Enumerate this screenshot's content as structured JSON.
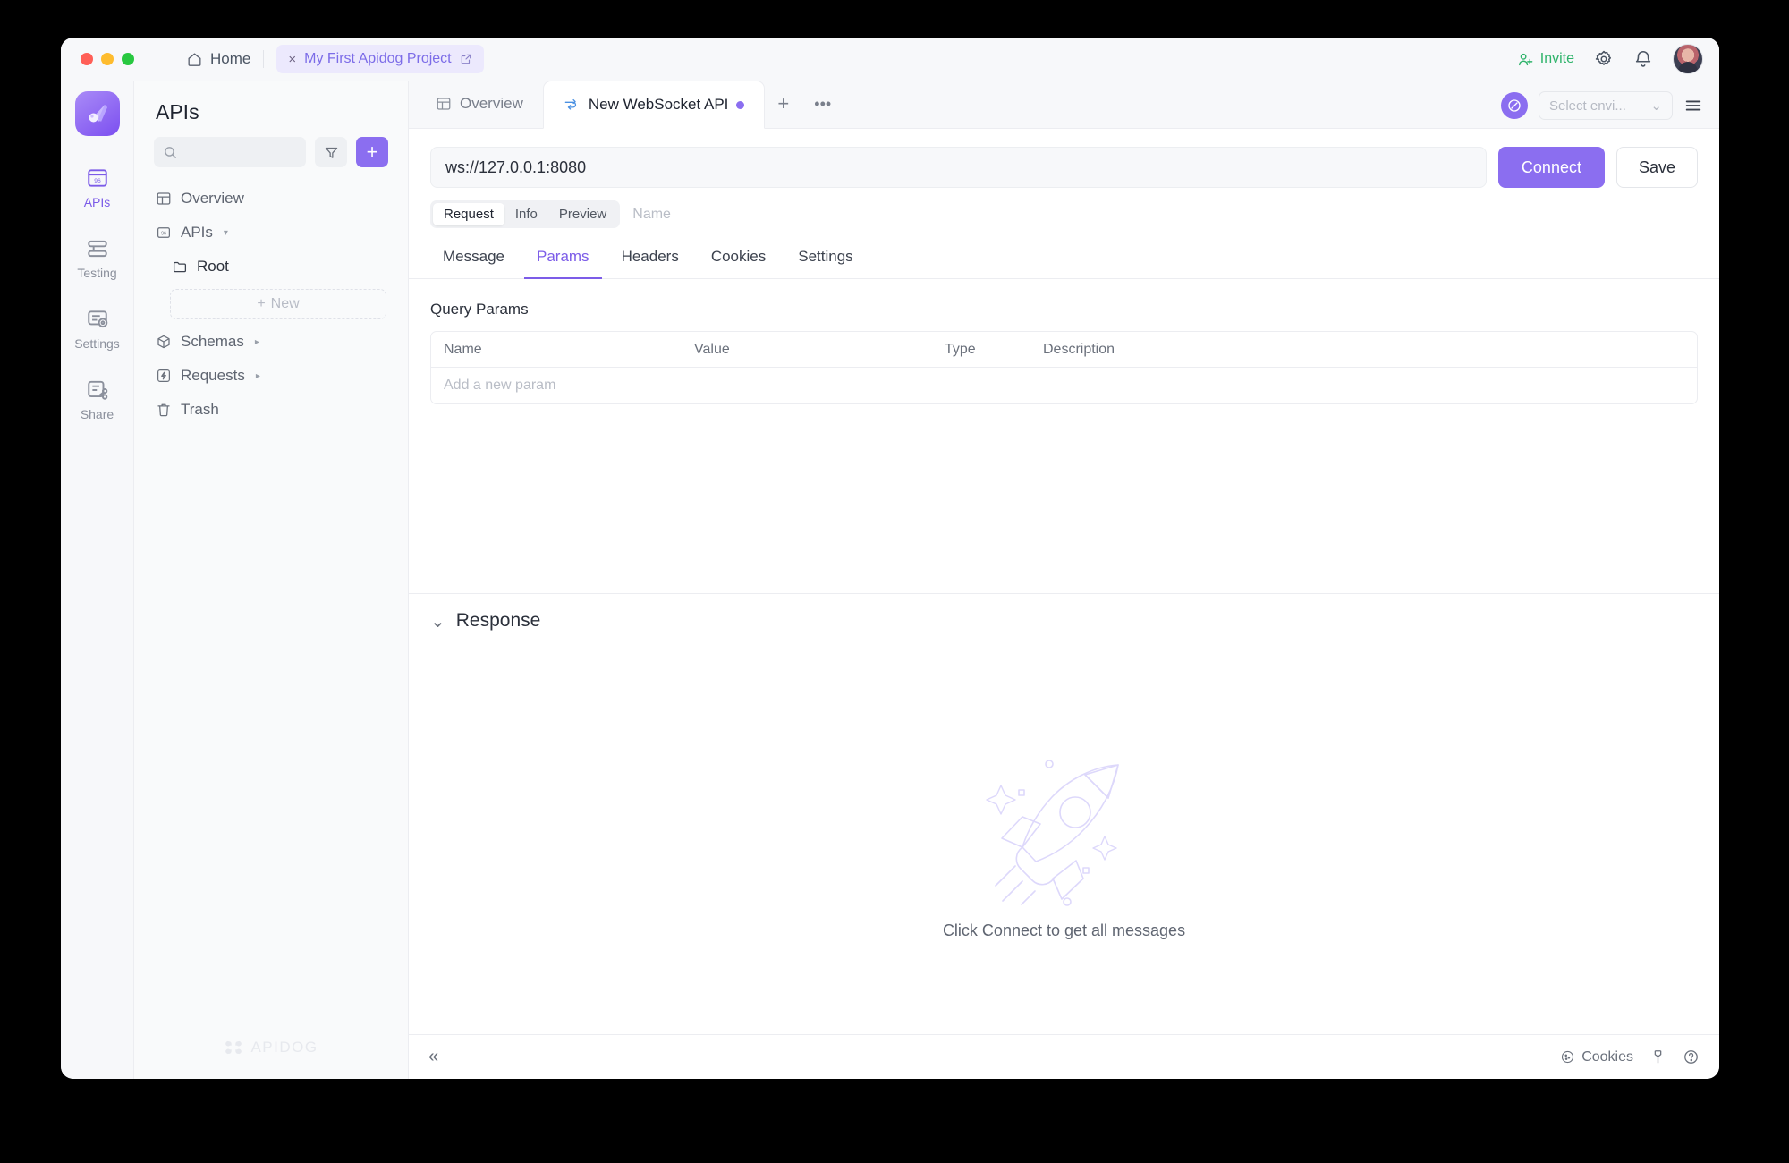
{
  "titlebar": {
    "home_label": "Home",
    "project_tab": "My First Apidog Project",
    "close_glyph": "×",
    "invite_label": "Invite"
  },
  "rail": {
    "items": [
      {
        "label": "APIs",
        "icon": "apis-icon",
        "active": true
      },
      {
        "label": "Testing",
        "icon": "testing-icon",
        "active": false
      },
      {
        "label": "Settings",
        "icon": "settings-icon",
        "active": false
      },
      {
        "label": "Share",
        "icon": "share-icon",
        "active": false
      }
    ]
  },
  "sidebar": {
    "title": "APIs",
    "search_placeholder": "",
    "add_glyph": "+",
    "items": [
      {
        "label": "Overview",
        "icon": "overview-icon",
        "caret": ""
      },
      {
        "label": "APIs",
        "icon": "apis-small-icon",
        "caret": "▾"
      },
      {
        "label": "Root",
        "icon": "folder-icon",
        "caret": ""
      },
      {
        "label": "Schemas",
        "icon": "schema-icon",
        "caret": "▸"
      },
      {
        "label": "Requests",
        "icon": "requests-icon",
        "caret": "▸"
      },
      {
        "label": "Trash",
        "icon": "trash-icon",
        "caret": ""
      }
    ],
    "new_label": "New",
    "new_glyph": "+",
    "watermark": "APIDOG"
  },
  "tabs": {
    "items": [
      {
        "label": "Overview",
        "icon": "overview-icon",
        "active": false,
        "unsaved": false
      },
      {
        "label": "New WebSocket API",
        "icon": "websocket-icon",
        "active": true,
        "unsaved": true
      }
    ],
    "add_glyph": "+",
    "more_glyph": "•••",
    "env_placeholder": "Select envi...",
    "env_caret": "⌄"
  },
  "request": {
    "url": "ws://127.0.0.1:8080",
    "url_placeholder": "ws://",
    "connect_label": "Connect",
    "save_label": "Save",
    "segments": [
      {
        "label": "Request",
        "active": true
      },
      {
        "label": "Info",
        "active": false
      },
      {
        "label": "Preview",
        "active": false
      }
    ],
    "name_placeholder": "Name",
    "subtabs": [
      {
        "label": "Message",
        "active": false
      },
      {
        "label": "Params",
        "active": true
      },
      {
        "label": "Headers",
        "active": false
      },
      {
        "label": "Cookies",
        "active": false
      },
      {
        "label": "Settings",
        "active": false
      }
    ],
    "params": {
      "section_label": "Query Params",
      "columns": [
        "Name",
        "Value",
        "Type",
        "Description"
      ],
      "rows": [],
      "add_row_placeholder": "Add a new param"
    }
  },
  "response": {
    "title": "Response",
    "collapse_glyph": "⌄",
    "empty_text": "Click Connect to get all messages",
    "empty_illustration": "rocket-icon"
  },
  "statusbar": {
    "collapse_glyph": "«",
    "cookies_label": "Cookies",
    "tools_icon": "wrench-icon",
    "help_icon": "help-icon"
  },
  "colors": {
    "accent": "#8b6ef0",
    "accent_text": "#7c5ce8",
    "invite_green": "#2eb36a",
    "ws_blue": "#4a90e2",
    "illustration": "#ddd8fb"
  }
}
